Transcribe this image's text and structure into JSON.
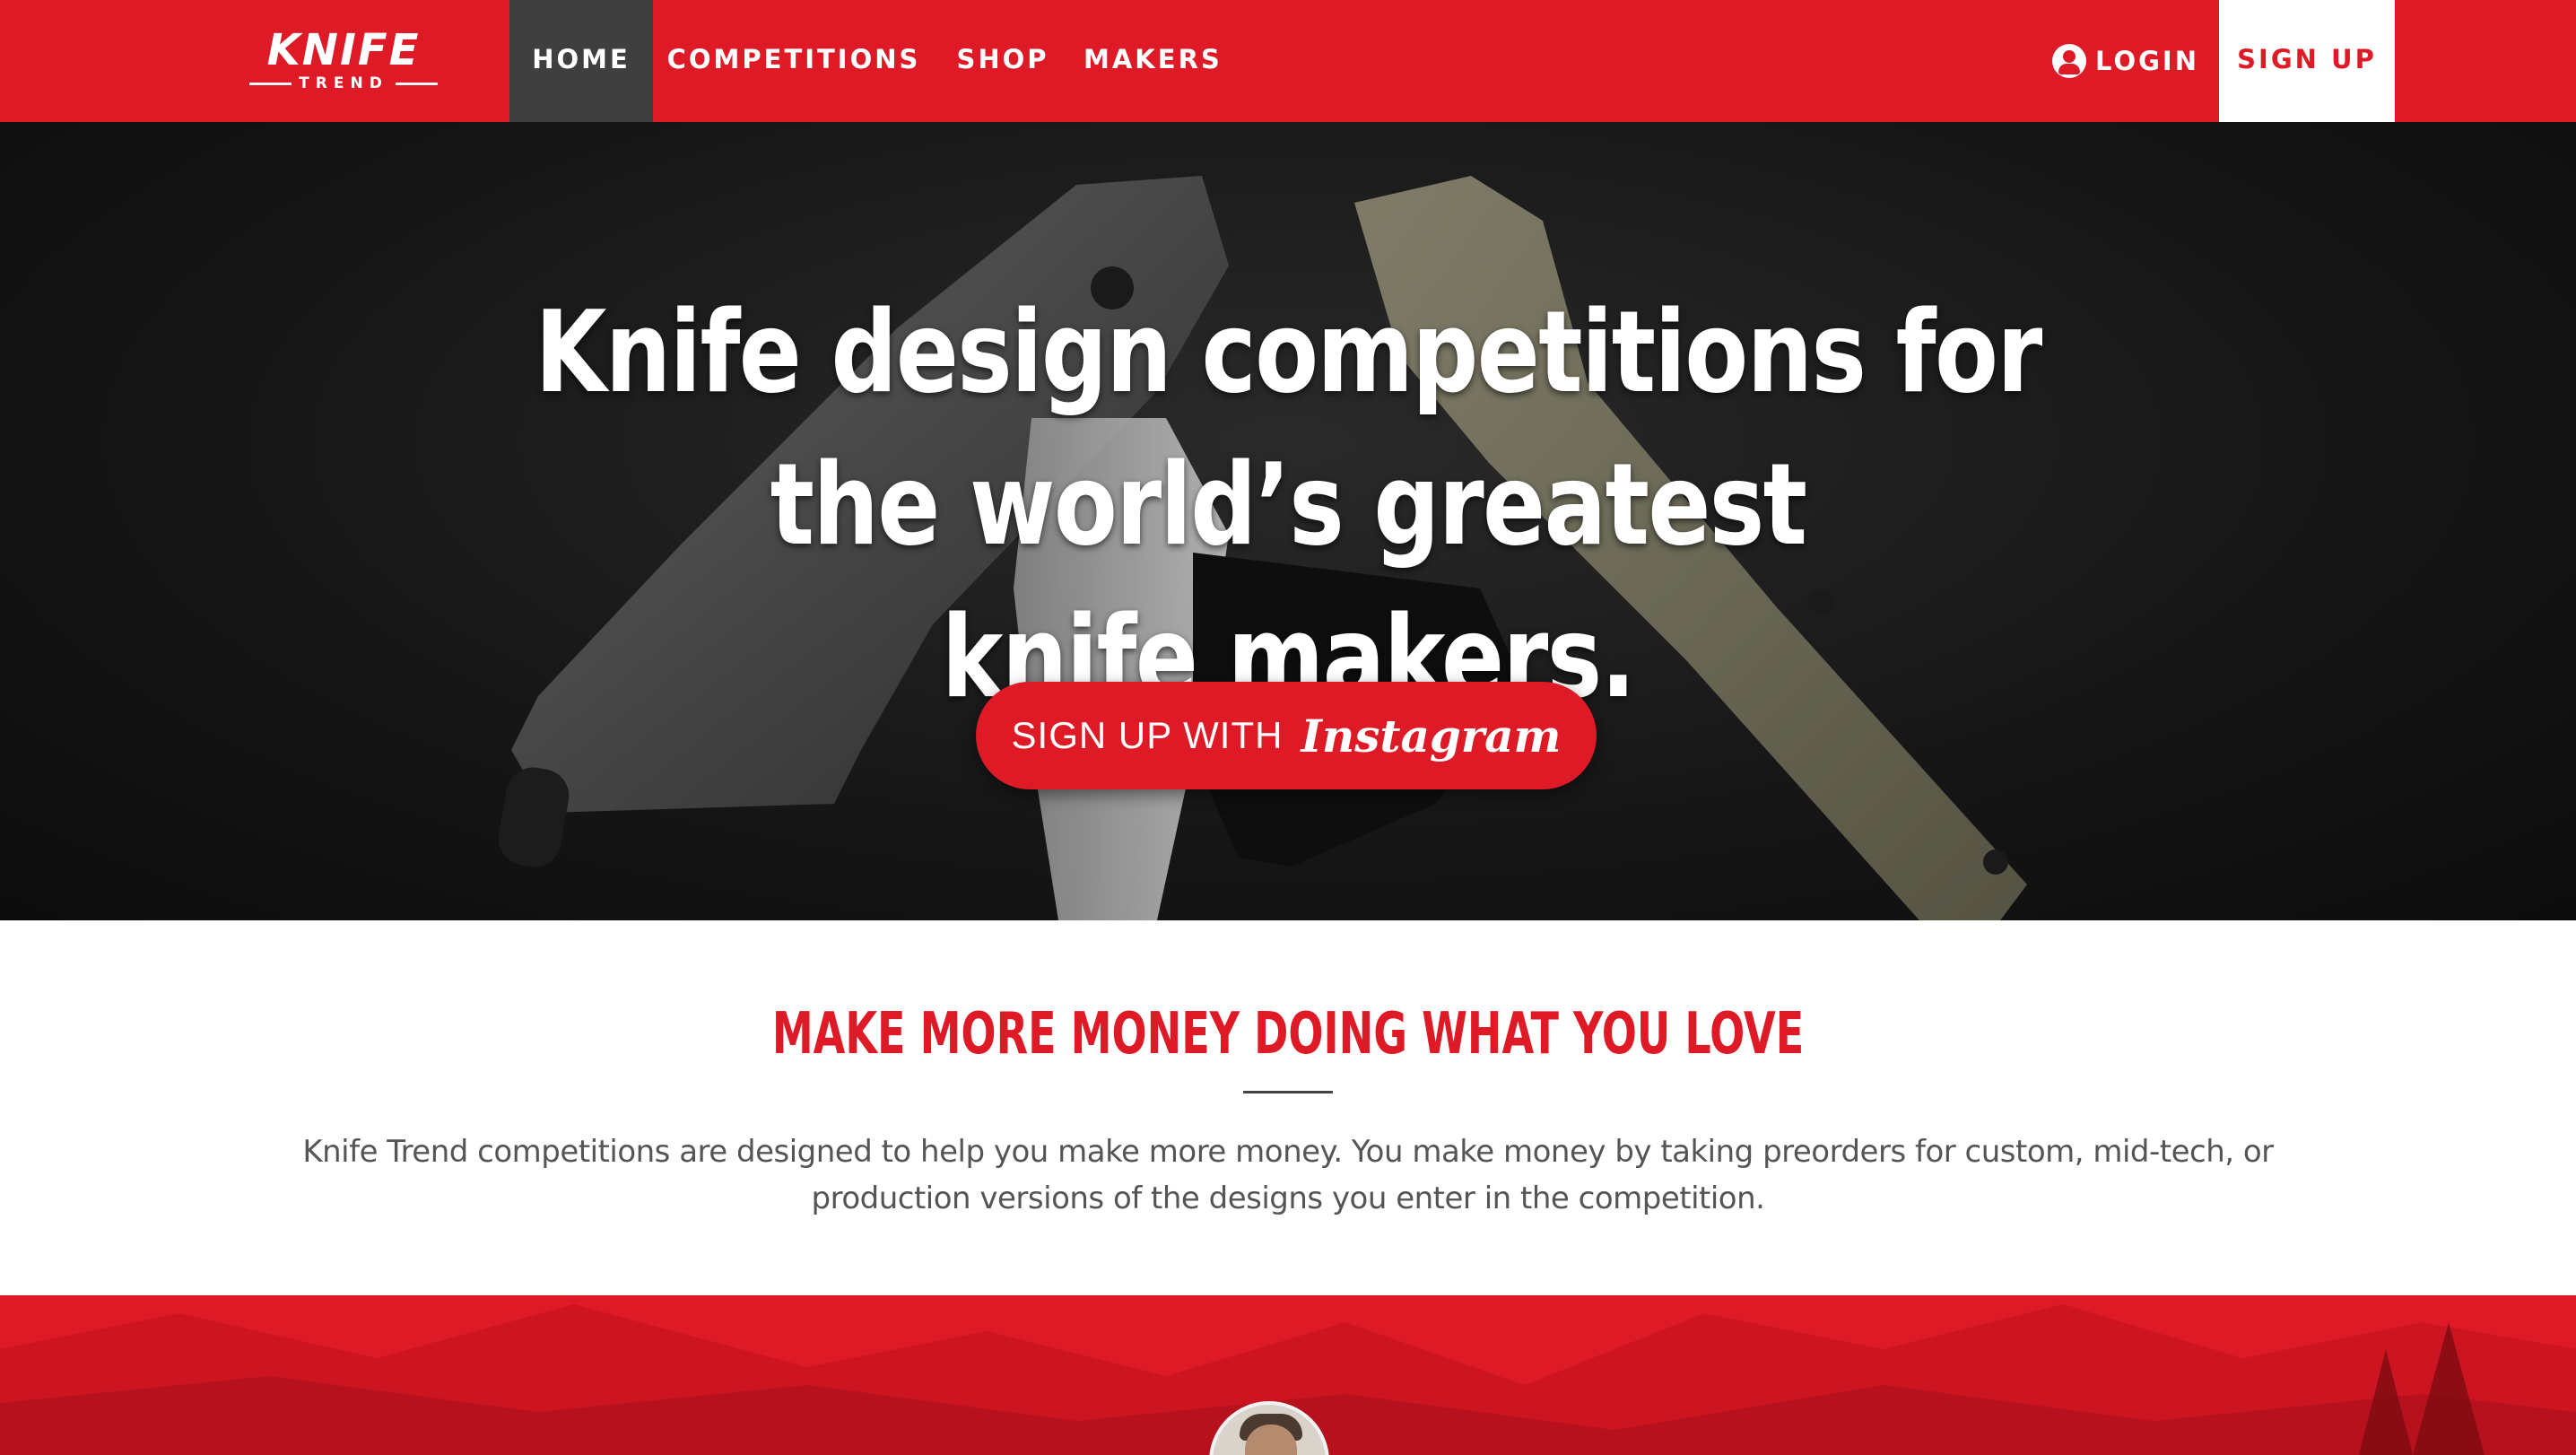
{
  "brand": {
    "name": "KNIFE",
    "sub": "TREND"
  },
  "nav": {
    "items": [
      {
        "label": "HOME",
        "active": true
      },
      {
        "label": "COMPETITIONS",
        "active": false
      },
      {
        "label": "SHOP",
        "active": false
      },
      {
        "label": "MAKERS",
        "active": false
      }
    ],
    "login": "LOGIN",
    "signup": "SIGN UP"
  },
  "hero": {
    "title_line1": "Knife design competitions for the world’s greatest",
    "title_line2": "knife makers.",
    "cta_plain": "SIGN UP WITH",
    "cta_brand": "Instagram"
  },
  "promo": {
    "heading": "MAKE MORE MONEY DOING WHAT YOU LOVE",
    "text_line1": "Knife Trend competitions are designed to help you make more money. You make money by taking preorders for custom, mid-tech, or",
    "text_line2": "production versions of the designs you enter in the competition."
  },
  "colors": {
    "accent": "#df1a27",
    "nav_active": "#3f3f3f",
    "hero_bg": "#171717",
    "text_body": "#555555"
  },
  "icons": {
    "login": "user-circle-icon"
  }
}
